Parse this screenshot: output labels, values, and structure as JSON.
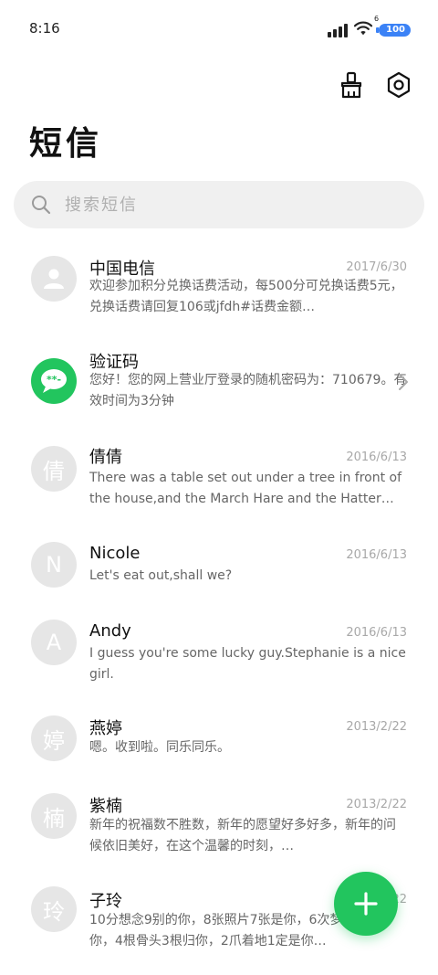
{
  "status": {
    "time": "8:16",
    "battery": "100",
    "wifi_badge": "6"
  },
  "header": {
    "title": "短信"
  },
  "search": {
    "placeholder": "搜索短信"
  },
  "messages": [
    {
      "name": "中国电信",
      "date": "2017/6/30",
      "preview": "欢迎参加积分兑换话费活动，每500分可兑换话费5元，兑换话费请回复106或jfdh#话费金额…",
      "avatar": ""
    },
    {
      "name": "验证码",
      "date": "",
      "preview": "您好！您的网上营业厅登录的随机密码为：710679。有效时间为3分钟",
      "avatar": ""
    },
    {
      "name": "倩倩",
      "date": "2016/6/13",
      "preview": "There was a table set out under a tree in front of the house,and the March Hare and the Hatter…",
      "avatar": "倩"
    },
    {
      "name": "Nicole",
      "date": "2016/6/13",
      "preview": "Let's eat out,shall we?",
      "avatar": "N"
    },
    {
      "name": "Andy",
      "date": "2016/6/13",
      "preview": "I guess you're some lucky guy.Stephanie is a nice girl.",
      "avatar": "A"
    },
    {
      "name": "燕婷",
      "date": "2013/2/22",
      "preview": "嗯。收到啦。同乐同乐。",
      "avatar": "婷"
    },
    {
      "name": "紫楠",
      "date": "2013/2/22",
      "preview": "新年的祝福数不胜数，新年的愿望好多好多，新年的问候依旧美好，在这个温馨的时刻，…",
      "avatar": "楠"
    },
    {
      "name": "子玲",
      "date": "2013/2/22",
      "preview": "10分想念9别的你，8张照片7张是你，6次梦里5只像你，4根骨头3根归你，2爪着地1定是你…",
      "avatar": "玲"
    }
  ],
  "colors": {
    "accent": "#22c55e",
    "battery": "#3b82f6"
  },
  "icons": {
    "clean": "broom-icon",
    "settings": "hex-settings-icon",
    "search": "search-icon",
    "add": "plus-icon"
  }
}
